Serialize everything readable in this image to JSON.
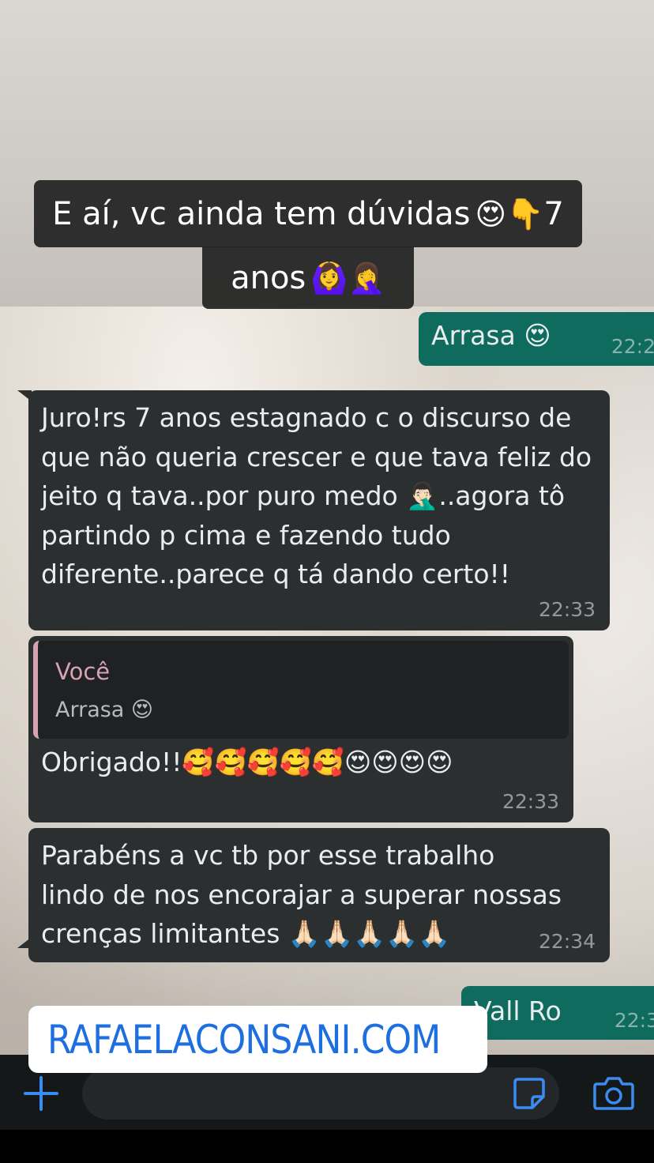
{
  "caption": {
    "line1": "E aí, vc ainda tem dúvidas",
    "line1_emojis": "😍👇",
    "line1_end": "7",
    "line2": "anos",
    "line2_emojis": "🙆‍♀️🤦‍♀️"
  },
  "messages": [
    {
      "direction": "out",
      "text": "Arrasa 😍",
      "time": "22:2"
    },
    {
      "direction": "in",
      "text": "Juro!rs 7 anos estagnado c o discurso de que não queria crescer e que tava feliz do jeito q tava..por puro medo 🤦🏻‍♂️..agora tô partindo p cima e fazendo tudo diferente..parece q tá dando certo!!",
      "time": "22:33"
    },
    {
      "direction": "in",
      "quote_author": "Você",
      "quote_text": "Arrasa 😍",
      "text": "Obrigado!!🥰🥰🥰🥰🥰😍😍😍😍",
      "time": "22:33"
    },
    {
      "direction": "in",
      "text": "Parabéns a vc tb por esse trabalho lindo de nos encorajar a superar nossas crenças limitantes 🙏🏻🙏🏻🙏🏻🙏🏻🙏🏻",
      "time": "22:34"
    },
    {
      "direction": "out",
      "text": "Vall Ro",
      "time": "22:3"
    }
  ],
  "link_sticker": {
    "text": "RAFAELACONSANI.COM",
    "icon": "link-icon"
  },
  "input_bar": {
    "icons": [
      "plus-icon",
      "sticker-icon",
      "camera-icon"
    ]
  },
  "colors": {
    "outgoing": "#0e6b5d",
    "incoming": "#2c2f30",
    "link": "#1d6fe0",
    "quote_author": "#d6a3b5"
  }
}
